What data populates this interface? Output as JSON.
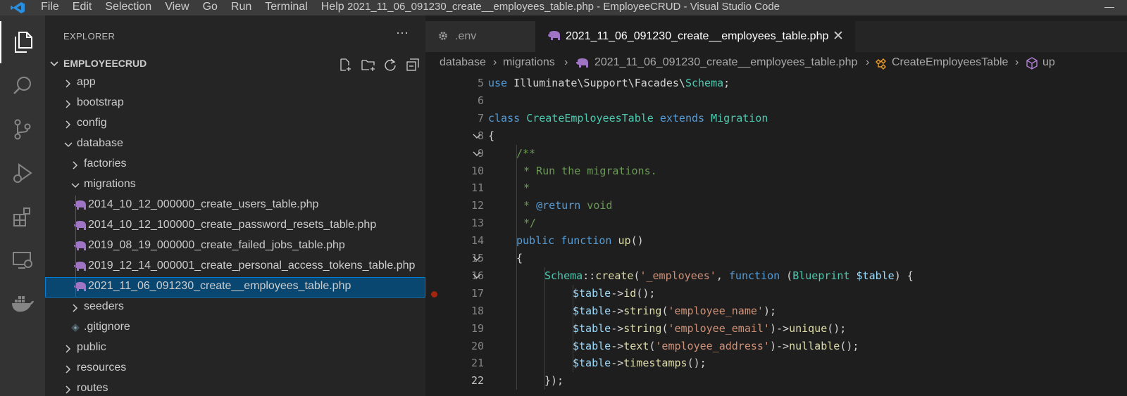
{
  "titlebar": {
    "menu": [
      "File",
      "Edit",
      "Selection",
      "View",
      "Go",
      "Run",
      "Terminal",
      "Help"
    ],
    "window_title": "2021_11_06_091230_create__employees_table.php - EmployeeCRUD - Visual Studio Code"
  },
  "activitybar": {
    "items": [
      "explorer-icon",
      "search-icon",
      "source-control-icon",
      "run-debug-icon",
      "extensions-icon",
      "remote-explorer-icon",
      "docker-icon"
    ]
  },
  "sidebar": {
    "title": "EXPLORER",
    "more": "···",
    "section": "EMPLOYEECRUD",
    "tree": [
      {
        "label": "app",
        "type": "folder",
        "open": false,
        "depth": 1
      },
      {
        "label": "bootstrap",
        "type": "folder",
        "open": false,
        "depth": 1
      },
      {
        "label": "config",
        "type": "folder",
        "open": false,
        "depth": 1
      },
      {
        "label": "database",
        "type": "folder",
        "open": true,
        "depth": 1
      },
      {
        "label": "factories",
        "type": "folder",
        "open": false,
        "depth": 2
      },
      {
        "label": "migrations",
        "type": "folder",
        "open": true,
        "depth": 2
      },
      {
        "label": "2014_10_12_000000_create_users_table.php",
        "type": "php",
        "depth": 3
      },
      {
        "label": "2014_10_12_100000_create_password_resets_table.php",
        "type": "php",
        "depth": 3
      },
      {
        "label": "2019_08_19_000000_create_failed_jobs_table.php",
        "type": "php",
        "depth": 3
      },
      {
        "label": "2019_12_14_000001_create_personal_access_tokens_table.php",
        "type": "php",
        "depth": 3
      },
      {
        "label": "2021_11_06_091230_create__employees_table.php",
        "type": "php",
        "depth": 3,
        "selected": true
      },
      {
        "label": "seeders",
        "type": "folder",
        "open": false,
        "depth": 2
      },
      {
        "label": ".gitignore",
        "type": "git",
        "depth": 2
      },
      {
        "label": "public",
        "type": "folder",
        "open": false,
        "depth": 1
      },
      {
        "label": "resources",
        "type": "folder",
        "open": false,
        "depth": 1
      },
      {
        "label": "routes",
        "type": "folder",
        "open": false,
        "depth": 1
      }
    ]
  },
  "tabs": [
    {
      "label": ".env",
      "active": false
    },
    {
      "label": "2021_11_06_091230_create__employees_table.php",
      "active": true
    }
  ],
  "breadcrumbs": [
    "database",
    "migrations",
    "2021_11_06_091230_create__employees_table.php",
    "CreateEmployeesTable",
    "up"
  ],
  "code": {
    "current_line": "22",
    "breakpoint_line": "17",
    "lines": [
      {
        "n": "5",
        "fold": false
      },
      {
        "n": "6",
        "fold": false
      },
      {
        "n": "7",
        "fold": false
      },
      {
        "n": "8",
        "fold": true
      },
      {
        "n": "9",
        "fold": true
      },
      {
        "n": "10",
        "fold": false
      },
      {
        "n": "11",
        "fold": false
      },
      {
        "n": "12",
        "fold": false
      },
      {
        "n": "13",
        "fold": false
      },
      {
        "n": "14",
        "fold": false
      },
      {
        "n": "15",
        "fold": true
      },
      {
        "n": "16",
        "fold": true
      },
      {
        "n": "17",
        "fold": false
      },
      {
        "n": "18",
        "fold": false
      },
      {
        "n": "19",
        "fold": false
      },
      {
        "n": "20",
        "fold": false
      },
      {
        "n": "21",
        "fold": false
      },
      {
        "n": "22",
        "fold": false
      }
    ],
    "tokens": {
      "l5": [
        "use",
        " Illuminate\\Support\\Facades\\",
        "Schema",
        ";"
      ],
      "l7": [
        "class",
        " ",
        "CreateEmployeesTable",
        " ",
        "extends",
        " ",
        "Migration"
      ],
      "l8": [
        "{"
      ],
      "l9": [
        "/**"
      ],
      "l10": [
        "* Run the migrations."
      ],
      "l11": [
        "*"
      ],
      "l12": [
        "* ",
        "@return",
        " void"
      ],
      "l13": [
        "*/"
      ],
      "l14": [
        "public",
        " ",
        "function",
        " ",
        "up",
        "()"
      ],
      "l15": [
        "{"
      ],
      "l16": [
        "Schema",
        "::",
        "create",
        "(",
        "'_employees'",
        ", ",
        "function",
        " (",
        "Blueprint",
        " ",
        "$table",
        ") {"
      ],
      "l17": [
        "$table",
        "->",
        "id",
        "();"
      ],
      "l18": [
        "$table",
        "->",
        "string",
        "(",
        "'employee_name'",
        ");"
      ],
      "l19": [
        "$table",
        "->",
        "string",
        "(",
        "'employee_email'",
        ")->",
        "unique",
        "();"
      ],
      "l20": [
        "$table",
        "->",
        "text",
        "(",
        "'employee_address'",
        ")->",
        "nullable",
        "();"
      ],
      "l21": [
        "$table",
        "->",
        "timestamps",
        "();"
      ],
      "l22": [
        "});"
      ]
    }
  }
}
